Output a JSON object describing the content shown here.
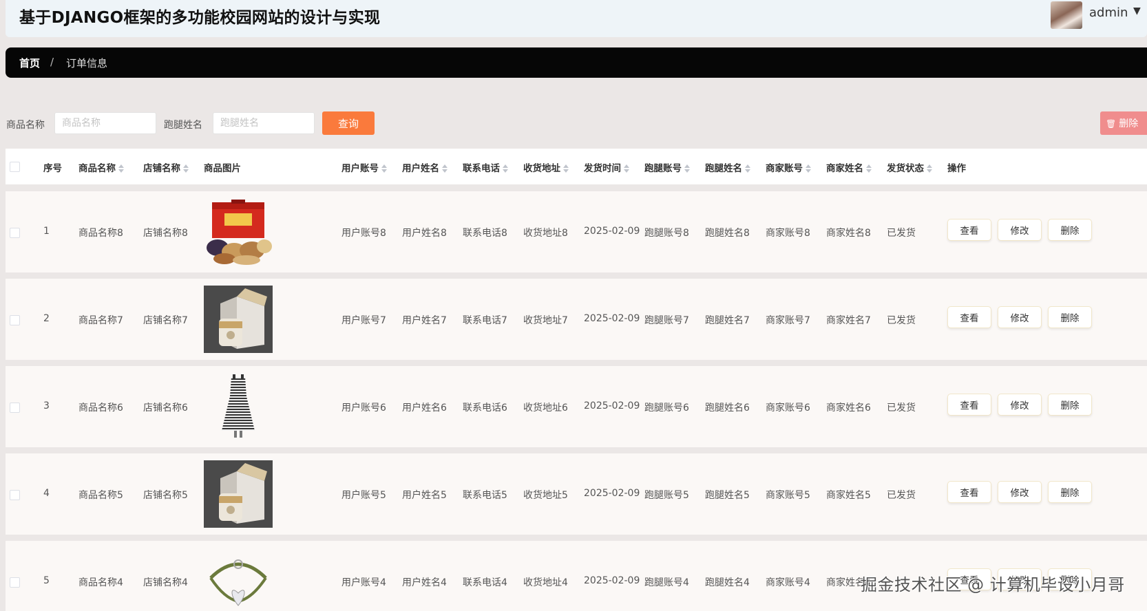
{
  "header": {
    "title": "基于DJANGO框架的多功能校园网站的设计与实现",
    "user": "admin",
    "user_caret_icon": "caret-down-icon"
  },
  "breadcrumb": {
    "home": "首页",
    "separator": "/",
    "current": "订单信息"
  },
  "search": {
    "product_label": "商品名称",
    "product_placeholder": "商品名称",
    "runner_label": "跑腿姓名",
    "runner_placeholder": "跑腿姓名",
    "query_button": "查询",
    "delete_button": "删除"
  },
  "colors": {
    "accent": "#fa7a3c",
    "danger": "#f08d8d",
    "breadcrumb_bg": "#060606",
    "header_bg": "#eef4f8"
  },
  "table": {
    "columns": [
      "序号",
      "商品名称",
      "店铺名称",
      "商品图片",
      "用户账号",
      "用户姓名",
      "联系电话",
      "收货地址",
      "发货时间",
      "跑腿账号",
      "跑腿姓名",
      "商家账号",
      "商家姓名",
      "发货状态",
      "操作"
    ],
    "action_labels": {
      "view": "查看",
      "edit": "修改",
      "delete": "删除"
    },
    "rows": [
      {
        "index": "1",
        "product": "商品名称8",
        "shop": "店铺名称8",
        "image": "gift-box-nuts",
        "user_account": "用户账号8",
        "user_name": "用户姓名8",
        "phone": "联系电话8",
        "address": "收货地址8",
        "ship_time": "2025-02-09",
        "runner_account": "跑腿账号8",
        "runner_name": "跑腿姓名8",
        "merchant_account": "商家账号8",
        "merchant_name": "商家姓名8",
        "status": "已发货"
      },
      {
        "index": "2",
        "product": "商品名称7",
        "shop": "店铺名称7",
        "image": "gift-package-jar",
        "user_account": "用户账号7",
        "user_name": "用户姓名7",
        "phone": "联系电话7",
        "address": "收货地址7",
        "ship_time": "2025-02-09",
        "runner_account": "跑腿账号7",
        "runner_name": "跑腿姓名7",
        "merchant_account": "商家账号7",
        "merchant_name": "商家姓名7",
        "status": "已发货"
      },
      {
        "index": "3",
        "product": "商品名称6",
        "shop": "店铺名称6",
        "image": "striped-dress",
        "user_account": "用户账号6",
        "user_name": "用户姓名6",
        "phone": "联系电话6",
        "address": "收货地址6",
        "ship_time": "2025-02-09",
        "runner_account": "跑腿账号6",
        "runner_name": "跑腿姓名6",
        "merchant_account": "商家账号6",
        "merchant_name": "商家姓名6",
        "status": "已发货"
      },
      {
        "index": "4",
        "product": "商品名称5",
        "shop": "店铺名称5",
        "image": "gift-package-jar",
        "user_account": "用户账号5",
        "user_name": "用户姓名5",
        "phone": "联系电话5",
        "address": "收货地址5",
        "ship_time": "2025-02-09",
        "runner_account": "跑腿账号5",
        "runner_name": "跑腿姓名5",
        "merchant_account": "商家账号5",
        "merchant_name": "商家姓名5",
        "status": "已发货"
      },
      {
        "index": "5",
        "product": "商品名称4",
        "shop": "店铺名称4",
        "image": "bracelet",
        "user_account": "用户账号4",
        "user_name": "用户姓名4",
        "phone": "联系电话4",
        "address": "收货地址4",
        "ship_time": "2025-02-09",
        "runner_account": "跑腿账号4",
        "runner_name": "跑腿姓名4",
        "merchant_account": "商家账号4",
        "merchant_name": "商家姓名4",
        "status": ""
      }
    ]
  },
  "watermark": "掘金技术社区 @ 计算机毕设小月哥"
}
